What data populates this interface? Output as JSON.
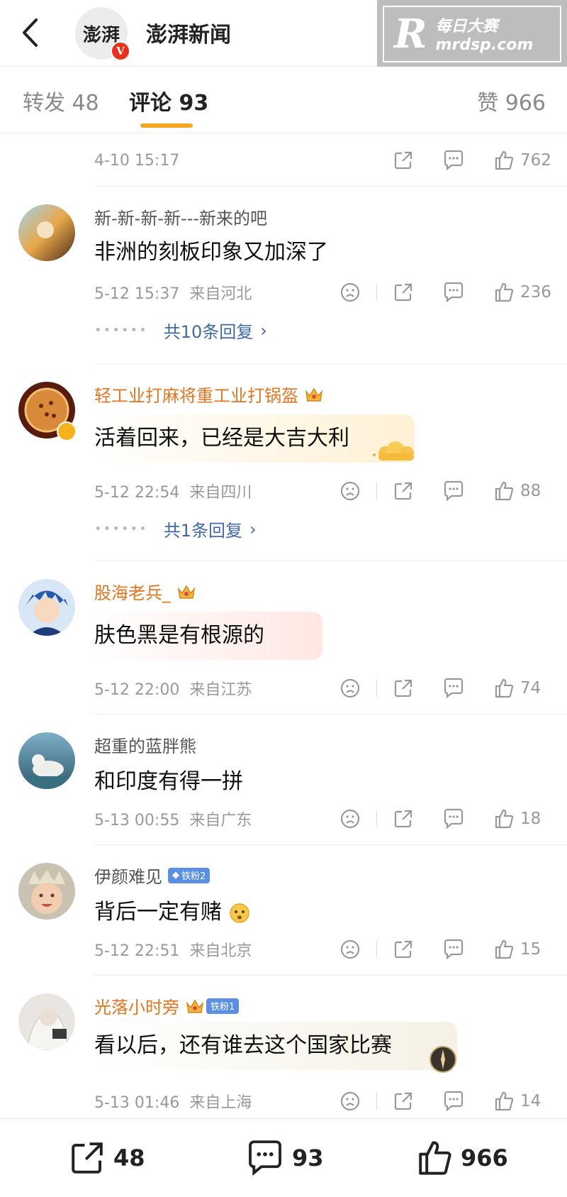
{
  "header": {
    "account_name": "澎湃新闻",
    "logo_text": "澎湃",
    "verified_mark": "V",
    "watermark_cn": "每日大赛",
    "watermark_en": "mrdsp.com",
    "watermark_letter": "R"
  },
  "tabs": [
    {
      "label": "转发 48"
    },
    {
      "label": "评论 93"
    },
    {
      "label": "赞 966"
    }
  ],
  "top_meta": {
    "timestamp": "4-10 15:17",
    "likes": "762"
  },
  "comments": [
    {
      "name": "新-新-新-新---新来的吧",
      "text": "非洲的刻板印象又加深了",
      "time": "5-12 15:37",
      "location": "来自河北",
      "likes": "236",
      "replies": "共10条回复"
    },
    {
      "name": "轻工业打麻将重工业打锅盔",
      "text": "活着回来，已经是大吉大利",
      "time": "5-12 22:54",
      "location": "来自四川",
      "likes": "88",
      "replies": "共1条回复"
    },
    {
      "name": "股海老兵_",
      "text": "肤色黑是有根源的",
      "time": "5-12 22:00",
      "location": "来自江苏",
      "likes": "74"
    },
    {
      "name": "超重的蓝胖熊",
      "text": "和印度有得一拼",
      "time": "5-13 00:55",
      "location": "来自广东",
      "likes": "18"
    },
    {
      "name": "伊颜难见",
      "badge": "铁粉2",
      "text": "背后一定有赌",
      "time": "5-12 22:51",
      "location": "来自北京",
      "likes": "15"
    },
    {
      "name": "光落小时旁",
      "badge": "铁粉1",
      "text": "看以后，还有谁去这个国家比赛",
      "time": "5-13 01:46",
      "location": "来自上海",
      "likes": "14"
    }
  ],
  "bottom_bar": {
    "repost_count": "48",
    "comment_count": "93",
    "like_count": "966"
  },
  "colors": {
    "accent": "#f5a623",
    "reply_link": "#3f6aa8",
    "vip_name": "#e2751f",
    "verified": "#e8301c"
  }
}
